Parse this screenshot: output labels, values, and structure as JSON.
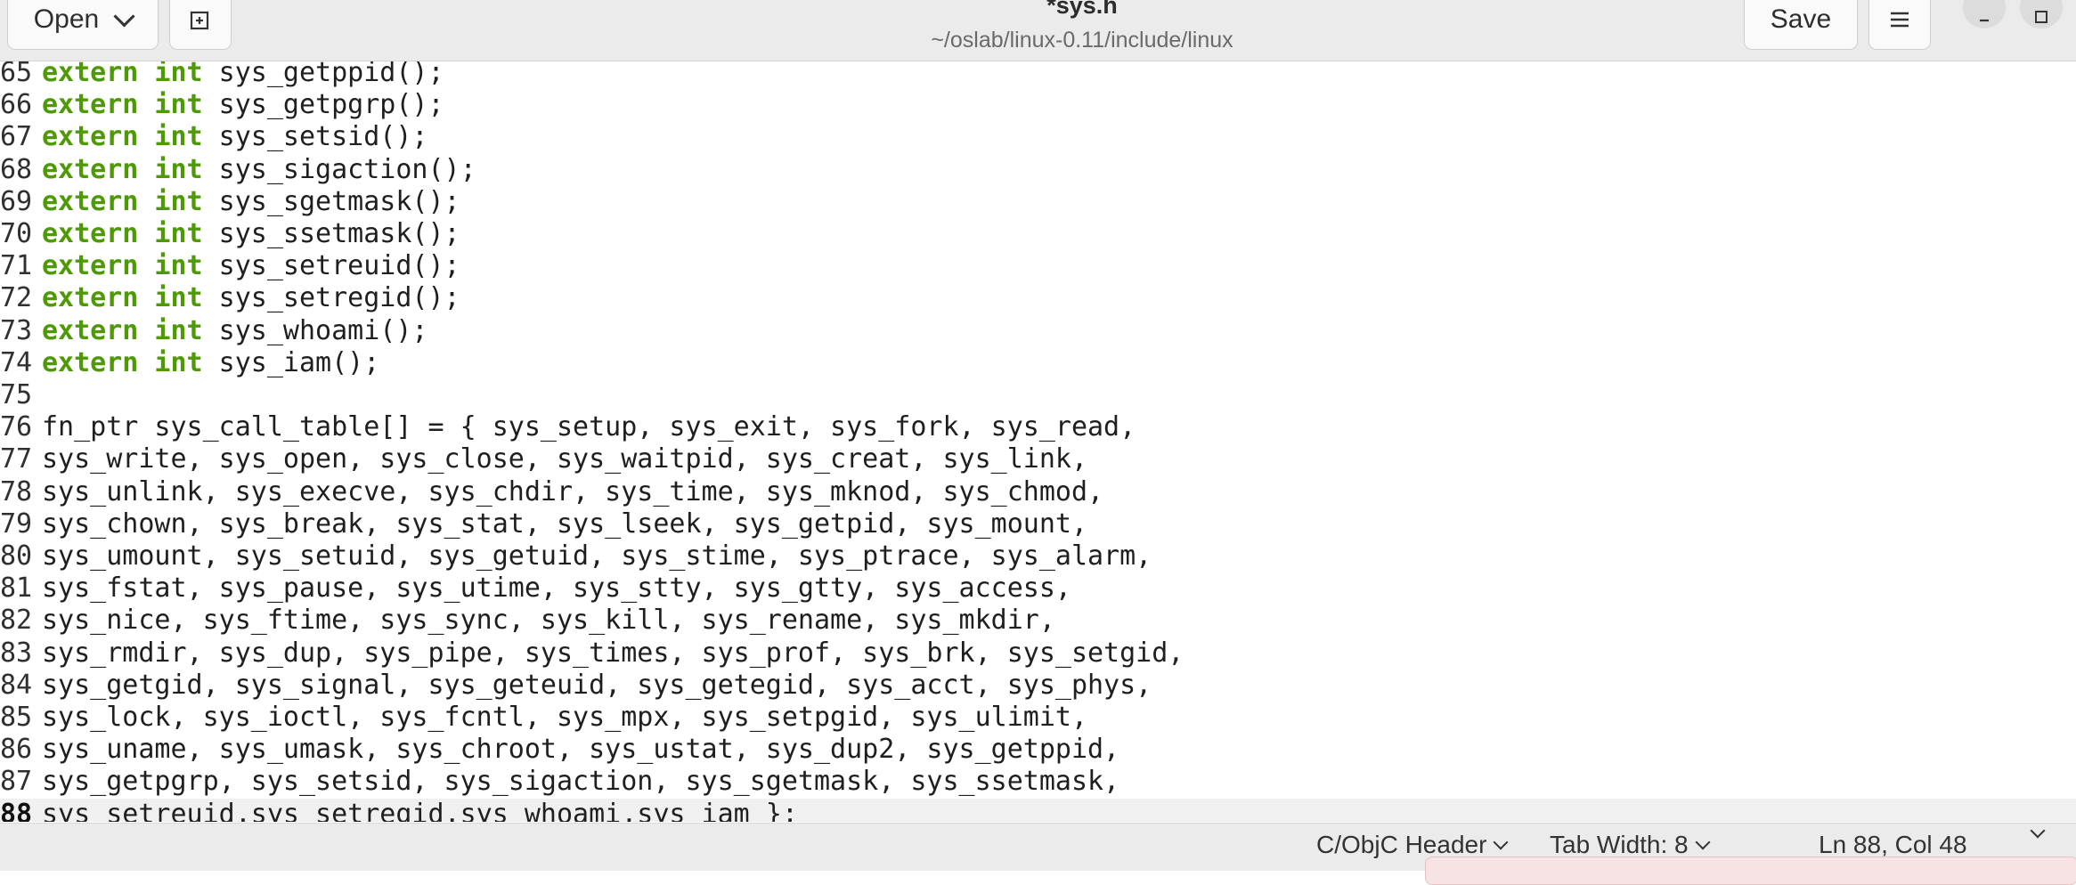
{
  "header": {
    "open_label": "Open",
    "save_label": "Save",
    "title": "*sys.h",
    "subtitle": "~/oslab/linux-0.11/include/linux",
    "icons": [
      "chevron-down-icon",
      "new-tab-icon",
      "hamburger-menu-icon",
      "minimize-icon",
      "maximize-icon"
    ]
  },
  "editor": {
    "keyword_color": "#4e9a06",
    "lines": [
      {
        "num": "65",
        "kw": "extern int",
        "rest": " sys_getppid();"
      },
      {
        "num": "66",
        "kw": "extern int",
        "rest": " sys_getpgrp();"
      },
      {
        "num": "67",
        "kw": "extern int",
        "rest": " sys_setsid();"
      },
      {
        "num": "68",
        "kw": "extern int",
        "rest": " sys_sigaction();"
      },
      {
        "num": "69",
        "kw": "extern int",
        "rest": " sys_sgetmask();"
      },
      {
        "num": "70",
        "kw": "extern int",
        "rest": " sys_ssetmask();"
      },
      {
        "num": "71",
        "kw": "extern int",
        "rest": " sys_setreuid();"
      },
      {
        "num": "72",
        "kw": "extern int",
        "rest": " sys_setregid();"
      },
      {
        "num": "73",
        "kw": "extern int",
        "rest": " sys_whoami();"
      },
      {
        "num": "74",
        "kw": "extern int",
        "rest": " sys_iam();"
      },
      {
        "num": "75",
        "kw": "",
        "rest": ""
      },
      {
        "num": "76",
        "kw": "",
        "rest": "fn_ptr sys_call_table[] = { sys_setup, sys_exit, sys_fork, sys_read,"
      },
      {
        "num": "77",
        "kw": "",
        "rest": "sys_write, sys_open, sys_close, sys_waitpid, sys_creat, sys_link,"
      },
      {
        "num": "78",
        "kw": "",
        "rest": "sys_unlink, sys_execve, sys_chdir, sys_time, sys_mknod, sys_chmod,"
      },
      {
        "num": "79",
        "kw": "",
        "rest": "sys_chown, sys_break, sys_stat, sys_lseek, sys_getpid, sys_mount,"
      },
      {
        "num": "80",
        "kw": "",
        "rest": "sys_umount, sys_setuid, sys_getuid, sys_stime, sys_ptrace, sys_alarm,"
      },
      {
        "num": "81",
        "kw": "",
        "rest": "sys_fstat, sys_pause, sys_utime, sys_stty, sys_gtty, sys_access,"
      },
      {
        "num": "82",
        "kw": "",
        "rest": "sys_nice, sys_ftime, sys_sync, sys_kill, sys_rename, sys_mkdir,"
      },
      {
        "num": "83",
        "kw": "",
        "rest": "sys_rmdir, sys_dup, sys_pipe, sys_times, sys_prof, sys_brk, sys_setgid,"
      },
      {
        "num": "84",
        "kw": "",
        "rest": "sys_getgid, sys_signal, sys_geteuid, sys_getegid, sys_acct, sys_phys,"
      },
      {
        "num": "85",
        "kw": "",
        "rest": "sys_lock, sys_ioctl, sys_fcntl, sys_mpx, sys_setpgid, sys_ulimit,"
      },
      {
        "num": "86",
        "kw": "",
        "rest": "sys_uname, sys_umask, sys_chroot, sys_ustat, sys_dup2, sys_getppid,"
      },
      {
        "num": "87",
        "kw": "",
        "rest": "sys_getpgrp, sys_setsid, sys_sigaction, sys_sgetmask, sys_ssetmask,"
      },
      {
        "num": "88",
        "kw": "",
        "rest": "sys_setreuid,sys_setregid,sys_whoami,sys_iam };",
        "current": true
      }
    ]
  },
  "statusbar": {
    "language": "C/ObjC Header",
    "tab_width": "Tab Width: 8",
    "position": "Ln 88, Col 48"
  }
}
